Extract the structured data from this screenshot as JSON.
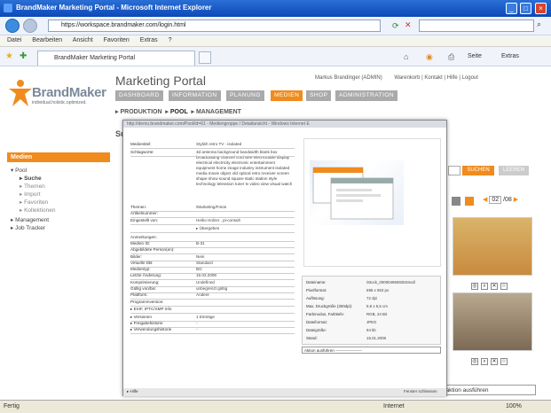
{
  "browser": {
    "title": "BrandMaker Marketing Portal - Microsoft Internet Explorer",
    "url": "https://workspace.brandmaker.com/login.html",
    "menu": [
      "Datei",
      "Bearbeiten",
      "Ansicht",
      "Favoriten",
      "Extras",
      "?"
    ],
    "tab_label": "BrandMaker Marketing Portal",
    "toolbar_right": [
      "Seite",
      "Extras"
    ],
    "status_left": "Fertig",
    "status_zone": "Internet",
    "zoom": "100%"
  },
  "portal": {
    "logo_word": "BrandMaker",
    "logo_tagline": "individual.holistic.optimized.",
    "app_title": "Marketing Portal",
    "user_links": [
      "Markus Brandinger (ADMIN)",
      "Warenkorb",
      "Kontakt",
      "Hilfe",
      "Logout"
    ],
    "nav_tabs": [
      "DASHBOARD",
      "INFORMATION",
      "PLANUNG",
      "MEDIEN",
      "SHOP",
      "ADMINISTRATION"
    ],
    "active_tab": "MEDIEN",
    "subnav": [
      "PRODUKTION",
      "POOL",
      "MANAGEMENT"
    ],
    "page_heading": "Su",
    "sidebar_title": "Medien",
    "tree": [
      "Pool",
      "Suche",
      "Themen",
      "Import",
      "Favoriten",
      "Kollektionen",
      "Management",
      "Job Tracker"
    ],
    "search_btn": "SUCHEN",
    "clear_btn": "LEEREN",
    "page_current": "02",
    "page_total": "/08",
    "bulk_action": "melaktion ausführen"
  },
  "popup": {
    "title": "http://demo.brandmaker.com/Pool/id=61 - Mediengroppe / Detailansicht - Windows Internet E",
    "fields": [
      {
        "label": "Medientitel:",
        "value": "Stylish retro TV - isolated"
      },
      {
        "label": "Schlagworte:",
        "value": "3d antenna background bandwidth blank box broadcasting channel cord wire electrocable display electrical electricity electronic entertainment equipment home image industry instrument isolated media movie object old optical retro receiver screen shape show sound square static station style technology television tuner tv video view visual watch"
      },
      {
        "label": "Themen:",
        "value": "/Marketing/Fotos"
      },
      {
        "label": "Artikelnummer:",
        "value": ""
      },
      {
        "label": "Eingestellt von:",
        "value": "Heiko Holzer , pi-consult"
      },
      {
        "label": "",
        "value": "▸ Übergeben"
      },
      {
        "label": "Anmerkungen:",
        "value": ""
      },
      {
        "label": "Medien ID:",
        "value": "B-31"
      },
      {
        "label": "Abgebildete Person(en):",
        "value": ""
      },
      {
        "label": "Bilder:",
        "value": "Nein"
      },
      {
        "label": "Virtuelle DB:",
        "value": "Standard"
      },
      {
        "label": "Medientyp:",
        "value": "BG"
      },
      {
        "label": "Letzte Änderung:",
        "value": "15.02.2008"
      },
      {
        "label": "Komprimierung:",
        "value": "Undefined"
      },
      {
        "label": "Gültig von/bis:",
        "value": "unbegrenzt gültig"
      },
      {
        "label": "Plattform:",
        "value": "Andere"
      },
      {
        "label": "Programmversion:",
        "value": ""
      },
      {
        "label": "▸ EXIF, IPTC/XMP Info",
        "value": ""
      },
      {
        "label": "▸ Versionen",
        "value": "1 Einträge"
      },
      {
        "label": "▸ Freigabehistorie",
        "value": "-"
      },
      {
        "label": "▸ Verwendungshistorie",
        "value": "-"
      }
    ],
    "meta": [
      {
        "label": "Dateiname:",
        "value": "iStock_000004950825Small"
      },
      {
        "label": "Pixelformat:",
        "value": "695 x 553 px"
      },
      {
        "label": "Auflösung:",
        "value": "72 dpi"
      },
      {
        "label": "Max. Druckgröße (300dpi):",
        "value": "5,9 x 5,5 cm"
      },
      {
        "label": "Farbmodus, Farbtiefe:",
        "value": "RGB, 24 Bit"
      },
      {
        "label": "Dateiformat:",
        "value": "JPEG"
      },
      {
        "label": "Dateigröße:",
        "value": "94 kb"
      },
      {
        "label": "Stand:",
        "value": "15.01.2008"
      }
    ],
    "action_select": "Aktion ausführen --------------------",
    "status": "▸ Hilfe",
    "close": "Fenster schliessen"
  }
}
